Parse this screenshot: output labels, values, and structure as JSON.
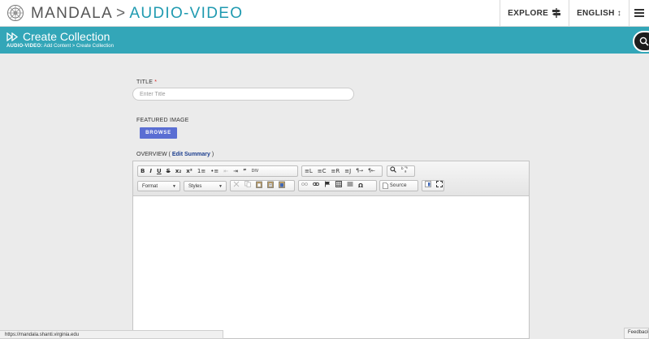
{
  "header": {
    "brand": "MANDALA",
    "separator": ">",
    "section": "AUDIO-VIDEO",
    "explore_label": "EXPLORE",
    "language_label": "ENGLISH ↕"
  },
  "banner": {
    "title": "Create Collection",
    "breadcrumb_root": "AUDIO-VIDEO:",
    "breadcrumb_path": "Add Content > Create Collection"
  },
  "form": {
    "title_label": "TITLE",
    "required_mark": "*",
    "title_placeholder": "Enter Title",
    "featured_image_label": "FEATURED IMAGE",
    "browse_label": "BROWSE",
    "overview_prefix": "OVERVIEW (",
    "edit_summary_label": "Edit Summary",
    "overview_suffix": ")"
  },
  "editor": {
    "toolbar_row1": {
      "group1": [
        "B",
        "I",
        "U",
        "S",
        "x₂",
        "x²",
        "1≡",
        "•≡",
        "⇤",
        "⇥",
        "”",
        "DIV"
      ],
      "group2": [
        "≡L",
        "≡C",
        "≡R",
        "≡J",
        "¶→",
        "¶←"
      ],
      "group3": [
        "find",
        "replace"
      ]
    },
    "format_label": "Format",
    "styles_label": "Styles",
    "toolbar_row2": {
      "group1": [
        "cut",
        "copy",
        "paste",
        "paste-text",
        "paste-word"
      ],
      "group2": [
        "unlink",
        "link",
        "anchor",
        "table",
        "hr",
        "Ω"
      ],
      "source_label": "Source",
      "group3": [
        "templates",
        "maximize"
      ]
    }
  },
  "status_bar": {
    "url": "https://mandala.shanti.virginia.edu"
  },
  "feedback_label": "Feedback",
  "colors": {
    "accent": "#33a6b8",
    "section_text": "#1f9ab0",
    "browse_button": "#5a6ed3",
    "link": "#1d3f8f",
    "required": "#dd2222"
  }
}
